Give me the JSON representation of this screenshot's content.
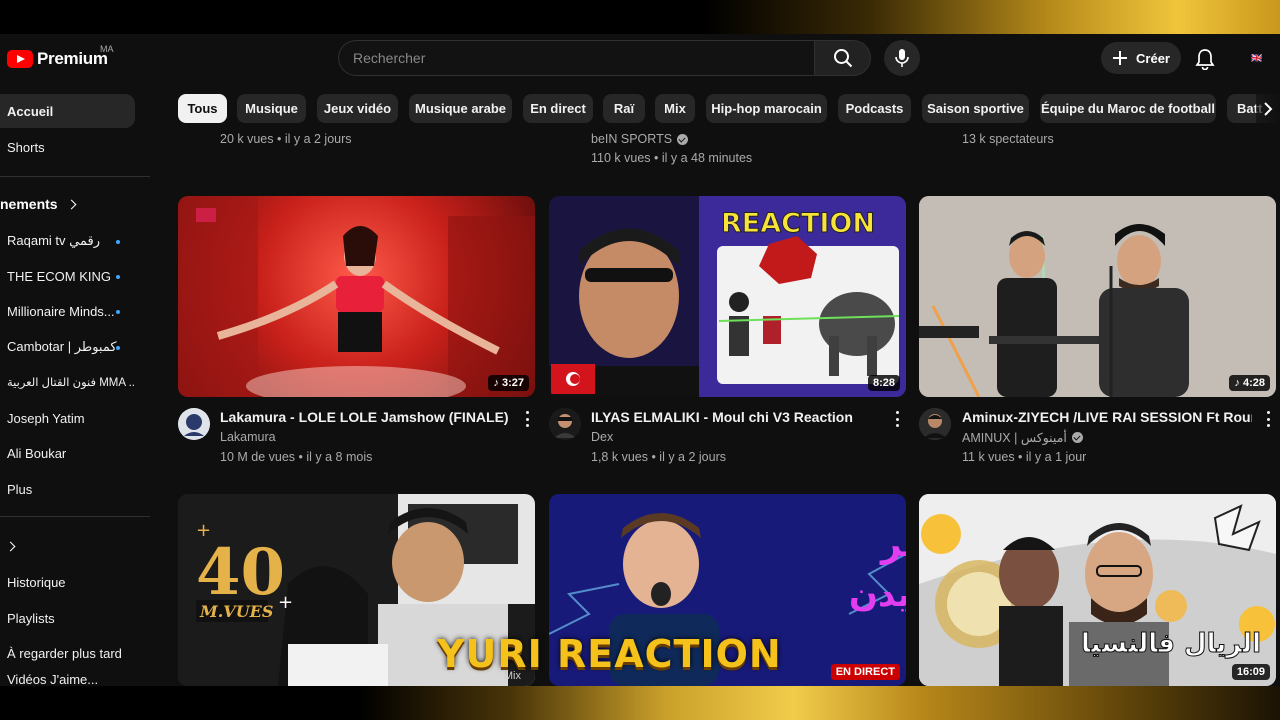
{
  "header": {
    "logo_text": "Premium",
    "country_code": "MA",
    "search_placeholder": "Rechercher",
    "create_label": "Créer",
    "profile_flag": "🇬🇧"
  },
  "sidebar": {
    "primary": [
      {
        "label": "Accueil"
      },
      {
        "label": "Shorts"
      }
    ],
    "subscriptions_heading": "nements",
    "subscriptions": [
      {
        "label": "Raqami tv رقمي"
      },
      {
        "label": "THE ECOM KING"
      },
      {
        "label": "Millionaire Minds..."
      },
      {
        "label": "Cambotar | كمبوطر"
      },
      {
        "label": "فنون القتال العربية MMA ..."
      },
      {
        "label": "Joseph Yatim"
      },
      {
        "label": "Ali Boukar"
      },
      {
        "label": "Plus"
      }
    ],
    "you_items": [
      {
        "label": "Historique"
      },
      {
        "label": "Playlists"
      },
      {
        "label": "À regarder plus tard"
      },
      {
        "label": "Vidéos J'aime..."
      }
    ]
  },
  "chips": [
    "Tous",
    "Musique",
    "Jeux vidéo",
    "Musique arabe",
    "En direct",
    "Raï",
    "Mix",
    "Hip-hop marocain",
    "Podcasts",
    "Saison sportive",
    "Équipe du Maroc de football",
    "Batt"
  ],
  "top_row": {
    "v1_meta": "20 k vues • il y a 2 jours",
    "v2_channel": "beIN SPORTS",
    "v2_meta": "110 k vues • il y a 48 minutes",
    "v3_meta": "13 k spectateurs"
  },
  "videos": [
    {
      "title": "Lakamura - LOLE LOLE  Jamshow (FINALE)",
      "channel": "Lakamura",
      "meta": "10 M de vues • il y a 8 mois",
      "duration": "♪ 3:27"
    },
    {
      "title": "ILYAS ELMALIKI - Moul chi V3 Reaction",
      "channel": "Dex",
      "meta": "1,8 k vues • il y a 2 jours",
      "duration": "8:28",
      "overlay": "REACTION"
    },
    {
      "title": "Aminux-ZIYECH /LIVE RAI SESSION Ft Roune",
      "channel": "AMINUX | أمينوكس",
      "meta": "11 k vues • il y a 1 jour",
      "duration": "♪ 4:28"
    }
  ],
  "bottom_row": {
    "v4_overlay_num": "40",
    "v4_overlay_sub": "M.VUES",
    "v4_badge": "Mix",
    "v5_overlay": "بث مباشر\nرايدن",
    "v5_badge": "EN DIRECT",
    "v6_overlay": "الريال فالنسيا",
    "v6_duration": "16:09"
  },
  "stream_banner": "YURI REACTION"
}
